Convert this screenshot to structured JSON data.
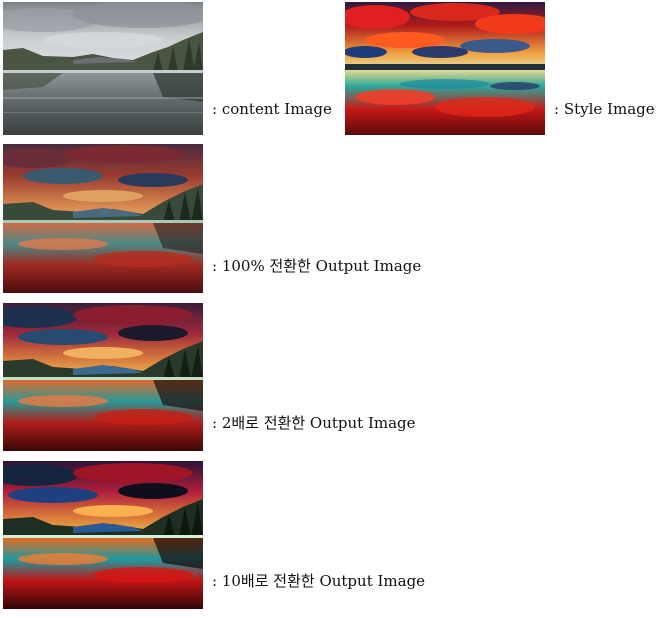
{
  "captions": {
    "content": ": content Image",
    "style": ": Style Image",
    "out100": ": 100% 전환한 Output Image",
    "out2x": ": 2배로 전환한 Output Image",
    "out10x": ": 10배로 전환한 Output Image"
  }
}
